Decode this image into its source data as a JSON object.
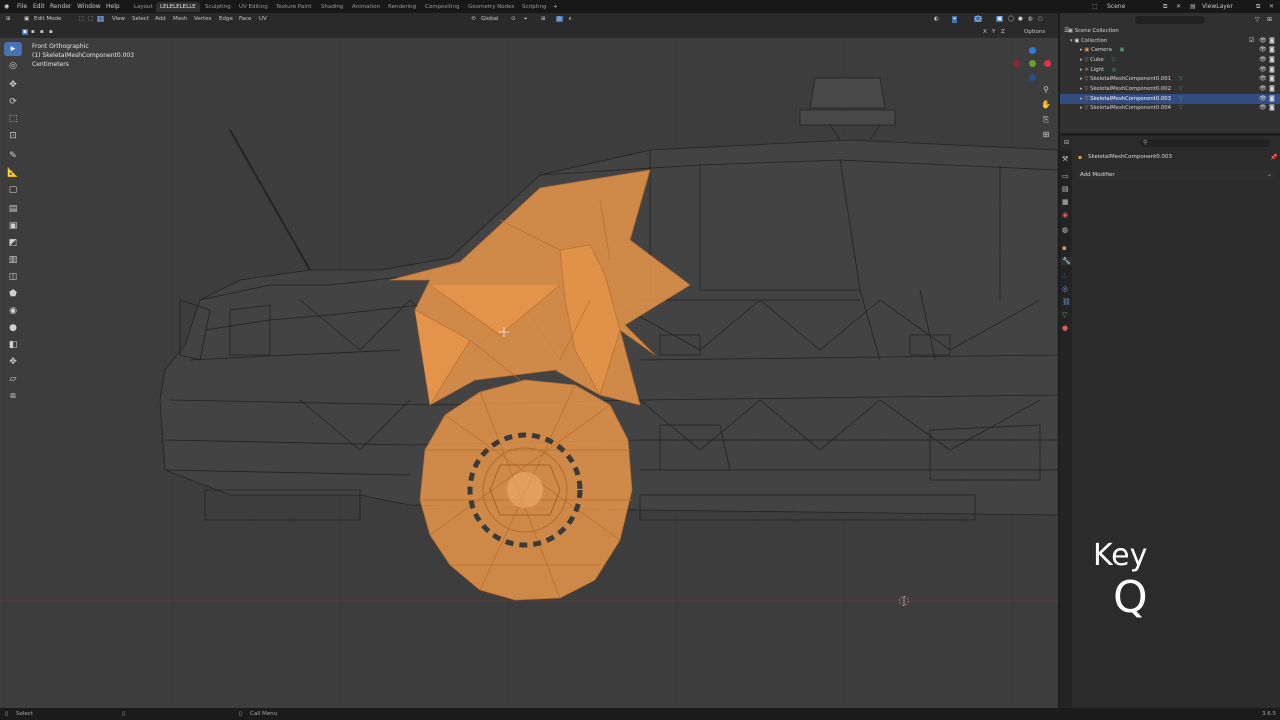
{
  "menu": [
    "File",
    "Edit",
    "Render",
    "Window",
    "Help"
  ],
  "workspaces": [
    {
      "label": "Layout",
      "active": false
    },
    {
      "label": "LELELELELLE",
      "active": true
    },
    {
      "label": "Sculpting",
      "active": false
    },
    {
      "label": "UV Editing",
      "active": false
    },
    {
      "label": "Texture Paint",
      "active": false
    },
    {
      "label": "Shading",
      "active": false
    },
    {
      "label": "Animation",
      "active": false
    },
    {
      "label": "Rendering",
      "active": false
    },
    {
      "label": "Compositing",
      "active": false
    },
    {
      "label": "Geometry Nodes",
      "active": false
    },
    {
      "label": "Scripting",
      "active": false
    }
  ],
  "scene": {
    "label": "Scene",
    "view_layer": "ViewLayer"
  },
  "header": {
    "mode": "Edit Mode",
    "menus": [
      "View",
      "Select",
      "Add",
      "Mesh",
      "Vertex",
      "Edge",
      "Face",
      "UV"
    ],
    "transform_orientation": "Global",
    "options": "Options",
    "axes": [
      "X",
      "Y",
      "Z"
    ]
  },
  "viewport": {
    "view_name": "Front Orthographic",
    "object_line": "(1) SkeletalMeshComponent0.003",
    "units": "Centimeters"
  },
  "outliner": {
    "root": "Scene Collection",
    "collection": "Collection",
    "items": [
      {
        "label": "Camera",
        "selected": false
      },
      {
        "label": "Cube",
        "selected": false
      },
      {
        "label": "Light",
        "selected": false
      },
      {
        "label": "SkeletalMeshComponent0.001",
        "selected": false
      },
      {
        "label": "SkeletalMeshComponent0.002",
        "selected": false
      },
      {
        "label": "SkeletalMeshComponent0.003",
        "selected": true
      },
      {
        "label": "SkeletalMeshComponent0.004",
        "selected": false
      }
    ]
  },
  "properties": {
    "object_name": "SkeletalMeshComponent0.003",
    "add_modifier": "Add Modifier"
  },
  "status": {
    "left": "Select",
    "middle": "Call Menu",
    "version": "3.6.5"
  },
  "keycast": {
    "label": "Key",
    "value": "Q"
  },
  "colors": {
    "accent": "#4772b3",
    "selection": "#e8954a",
    "viewport": "#3d3d3d"
  }
}
